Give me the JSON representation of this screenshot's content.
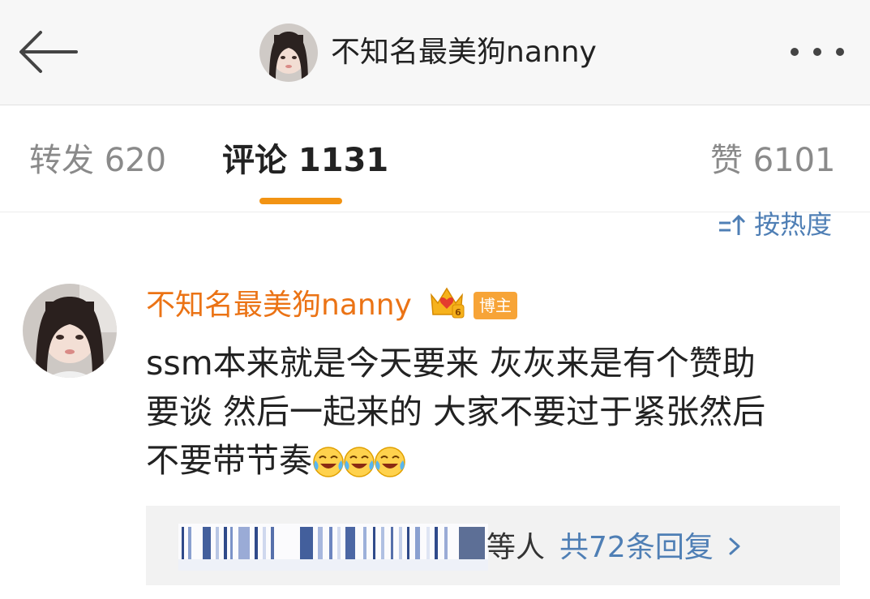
{
  "header": {
    "title": "不知名最美狗nanny",
    "back_icon": "arrow-left-icon",
    "more_icon": "more-dots-icon"
  },
  "tabs": {
    "repost_label": "转发 620",
    "comment_label": "评论 1131",
    "like_label": "赞 6101",
    "active": "comment",
    "indicator_color": "#f29313"
  },
  "sort": {
    "label": "按热度",
    "icon": "sort-arrows-icon"
  },
  "comment": {
    "author": "不知名最美狗nanny",
    "author_color": "#eb7315",
    "vip_icon": "crown-vip-icon",
    "badge": "博主",
    "lines": [
      "ssm本来就是今天要来 灰灰来是有个赞助",
      "要谈 然后一起来的 大家不要过于紧张然后",
      "不要带节奏"
    ],
    "emoji_icon": "laugh-cry-emoji-icon",
    "emoji_count": 3
  },
  "replies": {
    "others_label": "等人",
    "total_label": "共72条回复",
    "link_color": "#4f7fb5"
  }
}
